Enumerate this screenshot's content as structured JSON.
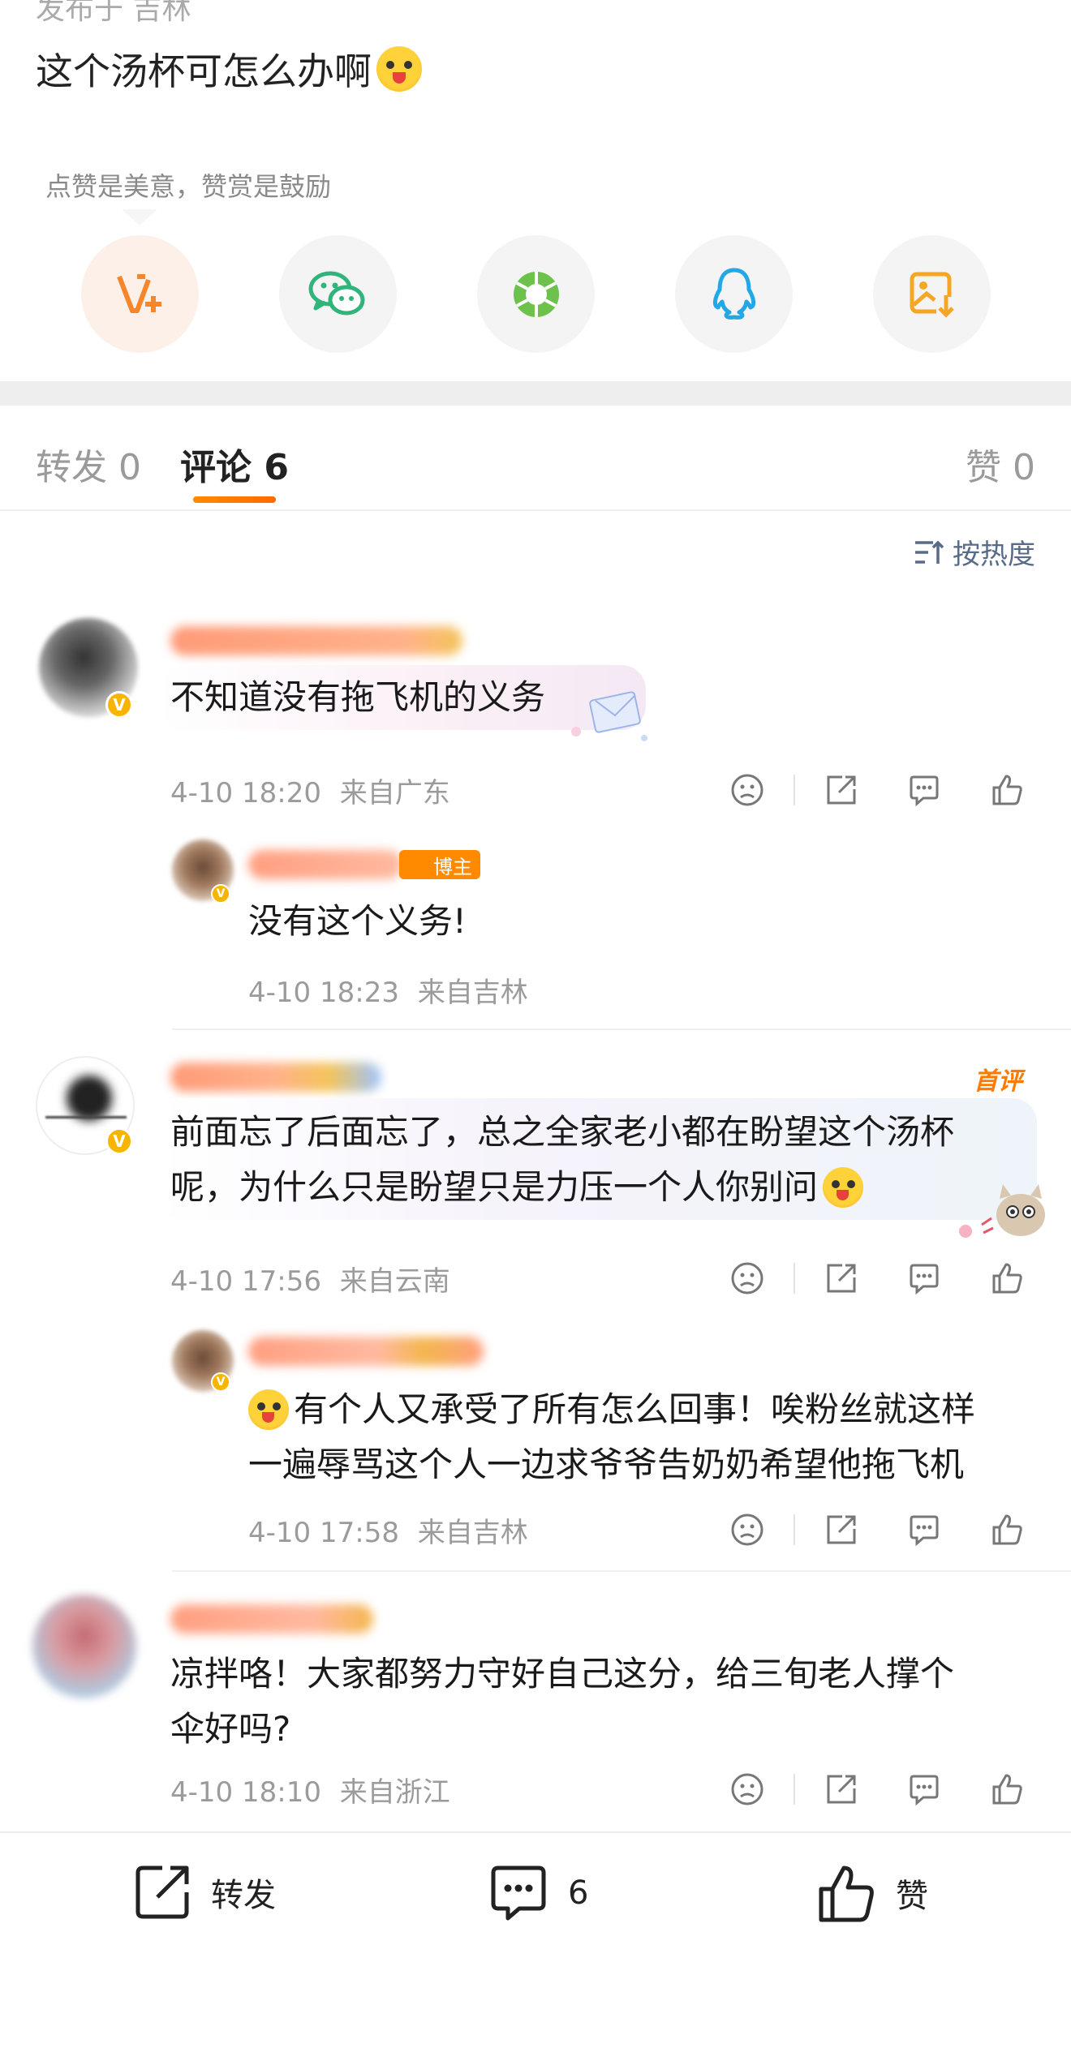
{
  "post": {
    "top_cut_text": "发布于 吉林",
    "text": "这个汤杯可怎么办啊",
    "tip": "点赞是美意，赞赏是鼓励"
  },
  "share_icons": [
    "reward-v-plus-icon",
    "wechat-icon",
    "moments-icon",
    "qq-icon",
    "save-image-icon"
  ],
  "tabs": {
    "repost_label": "转发 0",
    "comments_label": "评论 6",
    "likes_label": "赞 0"
  },
  "sort": {
    "label": "按热度"
  },
  "comments": [
    {
      "text": "不知道没有拖飞机的义务",
      "time": "4-10 18:20",
      "location": "来自广东",
      "reply": {
        "badge": "博主",
        "text": "没有这个义务!",
        "time": "4-10 18:23",
        "location": "来自吉林"
      }
    },
    {
      "badge": "首评",
      "text_line1": "前面忘了后面忘了，总之全家老小都在盼望这个汤杯",
      "text_line2": "呢，为什么只是盼望只是力压一个人你别问",
      "time": "4-10 17:56",
      "location": "来自云南",
      "reply": {
        "text_line1": "有个人又承受了所有怎么回事！唉粉丝就这样",
        "text_line2": "一遍辱骂这个人一边求爷爷告奶奶希望他拖飞机",
        "time": "4-10 17:58",
        "location": "来自吉林"
      }
    },
    {
      "text_line1": "凉拌咯！大家都努力守好自己这分，给三旬老人撑个",
      "text_line2": "伞好吗?",
      "time": "4-10 18:10",
      "location": "来自浙江"
    }
  ],
  "bottom_bar": {
    "repost_label": "转发",
    "comment_count": "6",
    "like_label": "赞"
  },
  "colors": {
    "accent": "#ff7a00",
    "verified": "#f7b500",
    "link": "#586b8a"
  }
}
